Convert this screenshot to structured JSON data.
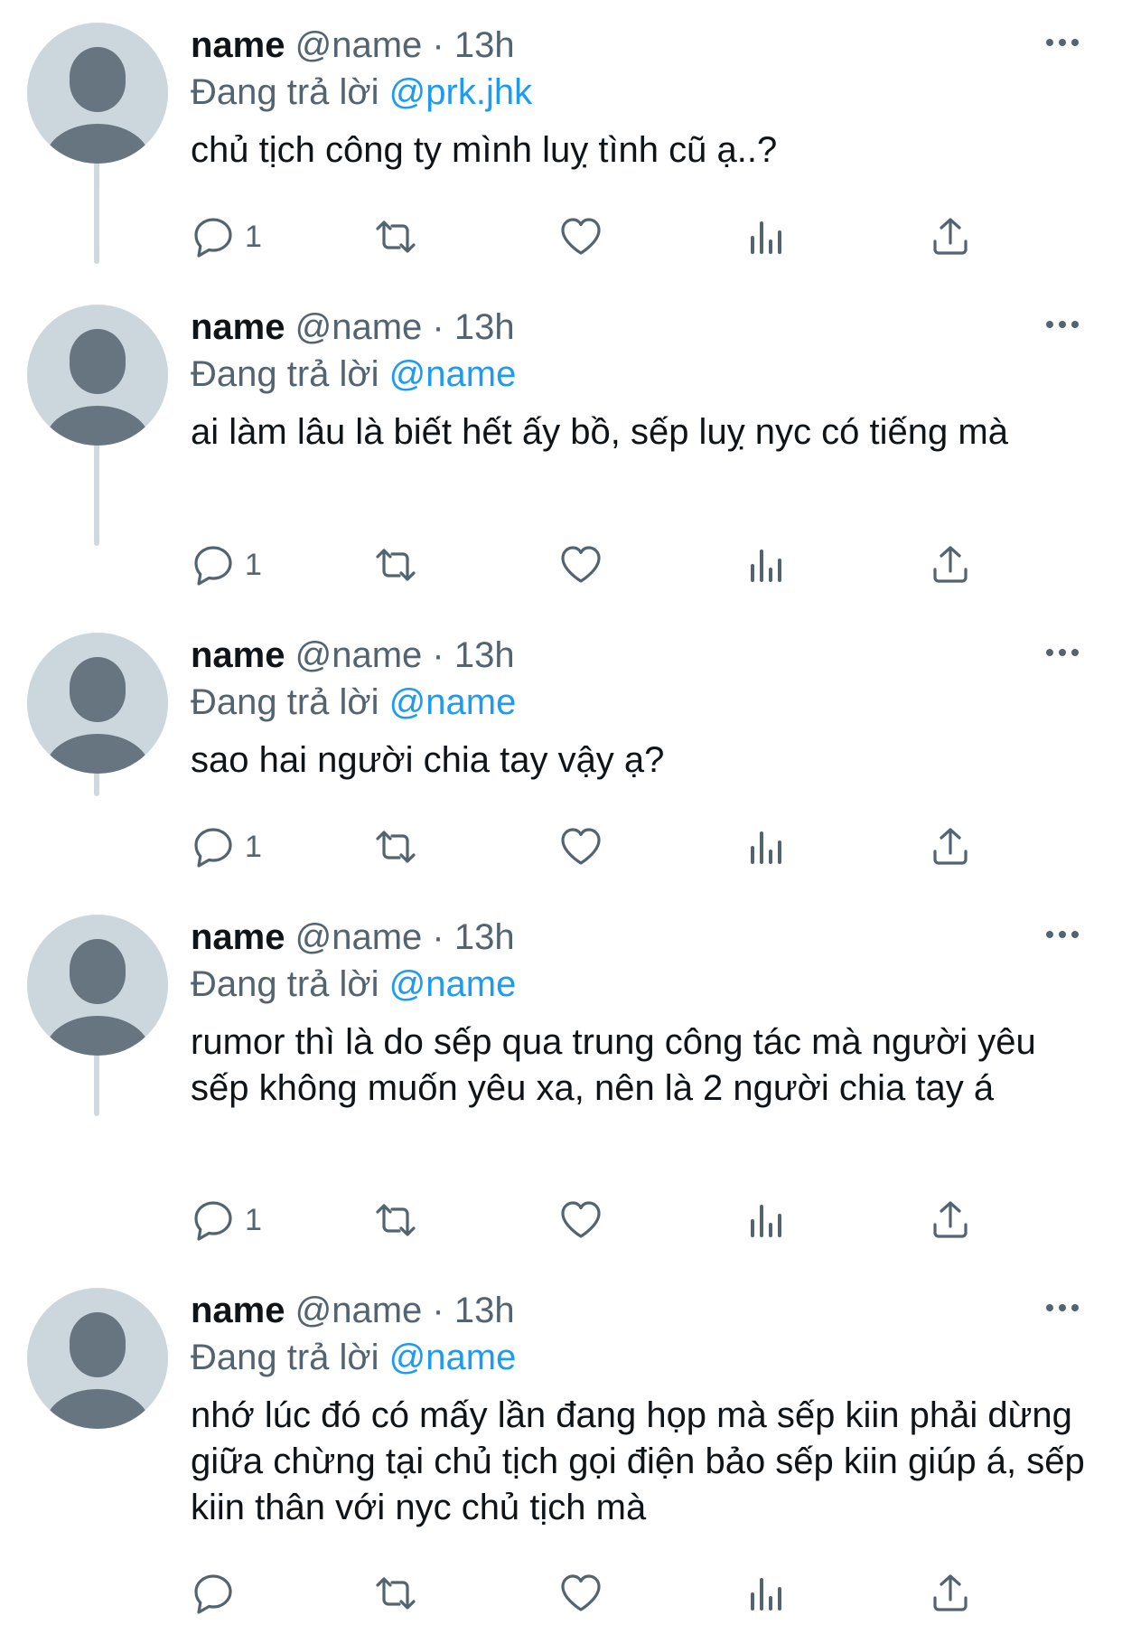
{
  "colors": {
    "accent": "#1d9bf0",
    "secondary_text": "#536471",
    "primary_text": "#0f1419",
    "avatar_bg": "#ccd6dd",
    "avatar_fg": "#66757f",
    "thread_line": "#cfd9de"
  },
  "icons": {
    "reply": "speech-bubble-icon",
    "retweet": "retweet-arrows-icon",
    "like": "heart-icon",
    "views": "bar-chart-icon",
    "share": "share-upload-icon",
    "more": "ellipsis-icon"
  },
  "tweets": [
    {
      "name": "name",
      "handle": "@name",
      "separator": "·",
      "time": "13h",
      "replying_label": "Đang trả lời",
      "replying_to": "@prk.jhk",
      "text": "chủ tịch công ty mình luỵ tình cũ ạ..?",
      "reply_count": "1"
    },
    {
      "name": "name",
      "handle": "@name",
      "separator": "·",
      "time": "13h",
      "replying_label": "Đang trả lời",
      "replying_to": "@name",
      "text": "ai làm lâu là biết hết ấy bồ, sếp luỵ nyc có tiếng mà",
      "reply_count": "1"
    },
    {
      "name": "name",
      "handle": "@name",
      "separator": "·",
      "time": "13h",
      "replying_label": "Đang trả lời",
      "replying_to": "@name",
      "text": "sao hai người chia tay vậy ạ?",
      "reply_count": "1"
    },
    {
      "name": "name",
      "handle": "@name",
      "separator": "·",
      "time": "13h",
      "replying_label": "Đang trả lời",
      "replying_to": "@name",
      "text": "rumor thì là do sếp qua trung công tác mà người yêu sếp không muốn yêu xa, nên là 2 người chia tay á",
      "reply_count": "1"
    },
    {
      "name": "name",
      "handle": "@name",
      "separator": "·",
      "time": "13h",
      "replying_label": "Đang trả lời",
      "replying_to": "@name",
      "text": "nhớ lúc đó có mấy lần đang họp mà sếp kiin phải dừng giữa chừng tại chủ tịch gọi điện bảo sếp kiin giúp á, sếp kiin thân với nyc chủ tịch mà",
      "reply_count": ""
    }
  ]
}
